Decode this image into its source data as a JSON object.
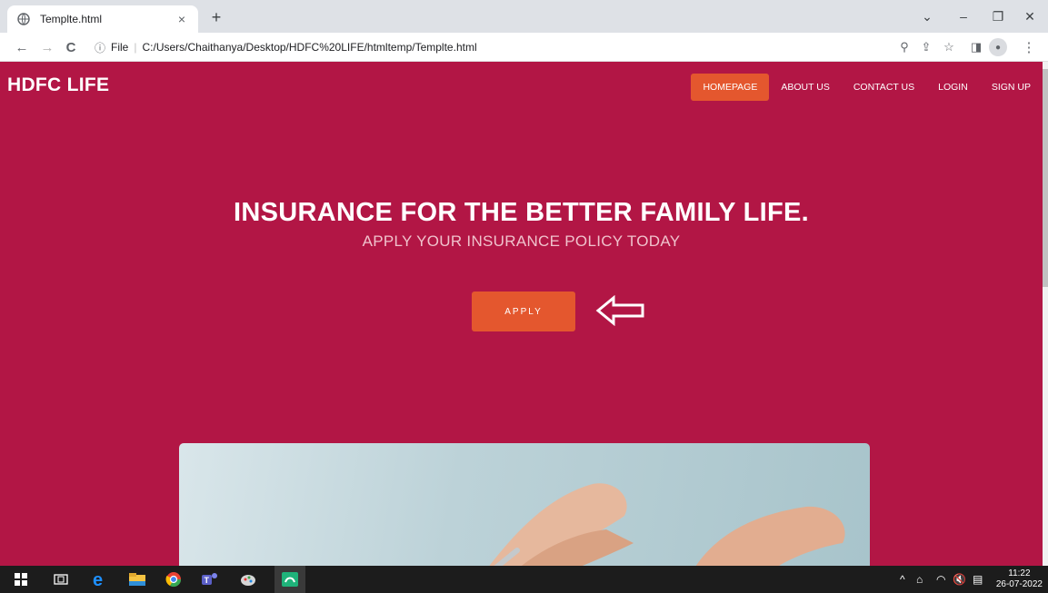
{
  "browser": {
    "tab_title": "Templte.html",
    "tab_close": "×",
    "new_tab": "+",
    "window_controls": {
      "dropdown": "⌄",
      "minimize": "–",
      "restore": "❐",
      "close": "✕"
    },
    "nav": {
      "back": "←",
      "forward": "→",
      "reload": "C"
    },
    "address": {
      "info_icon": "ⓘ",
      "scheme_label": "File",
      "separator": "|",
      "url": "C:/Users/Chaithanya/Desktop/HDFC%20LIFE/htmltemp/Templte.html"
    },
    "toolbar_icons": {
      "zoom": "⚲",
      "share": "⇪",
      "bookmark": "☆",
      "sidepanel": "◨",
      "profile": "●",
      "menu": "⋮"
    }
  },
  "site": {
    "brand": "HDFC LIFE",
    "nav": [
      {
        "label": "HOMEPAGE",
        "active": true
      },
      {
        "label": "ABOUT US",
        "active": false
      },
      {
        "label": "CONTACT US",
        "active": false
      },
      {
        "label": "LOGIN",
        "active": false
      },
      {
        "label": "SIGN UP",
        "active": false
      }
    ],
    "hero": {
      "title": "INSURANCE FOR THE BETTER FAMILY LIFE.",
      "subtitle": "APPLY YOUR INSURANCE POLICY TODAY",
      "button": "APPLY"
    },
    "colors": {
      "background": "#b21645",
      "accent": "#e4572e"
    }
  },
  "taskbar": {
    "icons": [
      "windows-start-icon",
      "task-view-icon",
      "edge-icon",
      "file-explorer-icon",
      "chrome-icon",
      "teams-icon",
      "paint-icon",
      "remote-icon"
    ],
    "tray_icons": {
      "chevron": "^",
      "network": "⌂",
      "wifi": "◠",
      "volume": "🔇",
      "notifications": "▤"
    },
    "time": "11:22",
    "date": "26-07-2022"
  }
}
